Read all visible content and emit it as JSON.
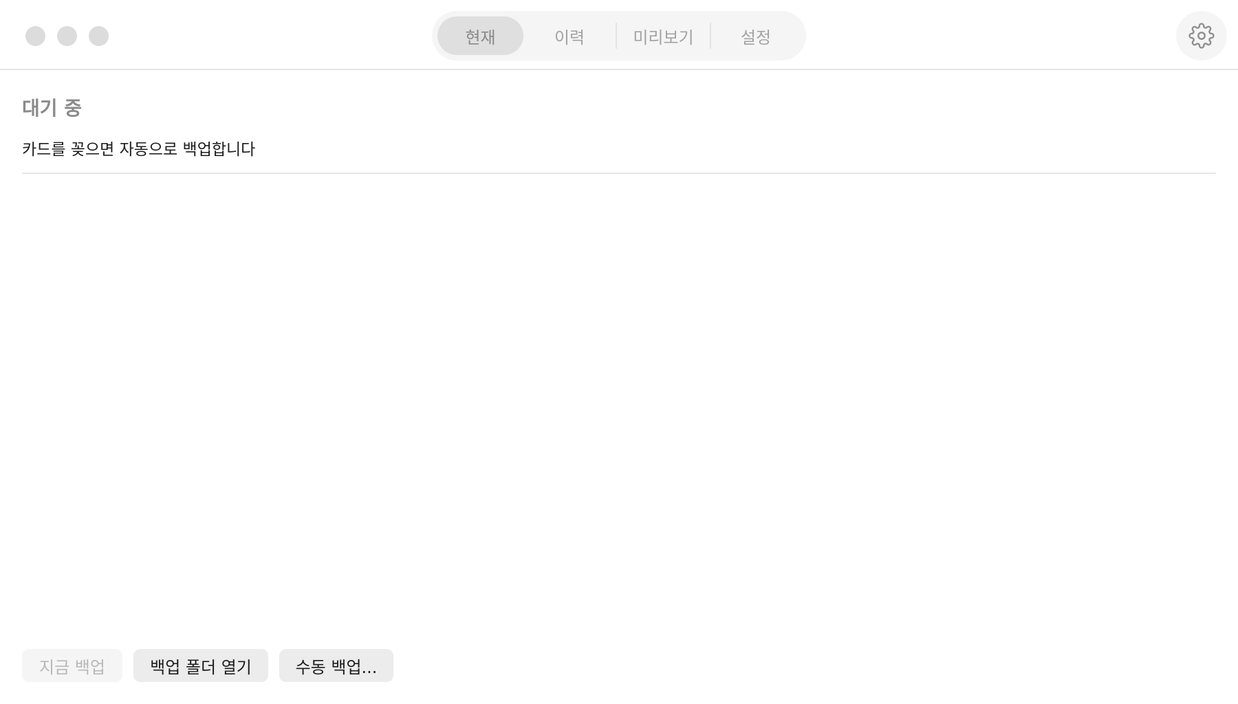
{
  "window": {
    "traffic_lights": [
      "close",
      "minimize",
      "zoom"
    ]
  },
  "tabs": [
    {
      "label": "현재",
      "active": true
    },
    {
      "label": "이력",
      "active": false
    },
    {
      "label": "미리보기",
      "active": false
    },
    {
      "label": "설정",
      "active": false
    }
  ],
  "toolbar": {
    "settings_icon": "gear-icon"
  },
  "status": {
    "title": "대기 중",
    "description": "카드를 꽂으면 자동으로 백업합니다"
  },
  "actions": {
    "backup_now": {
      "label": "지금 백업",
      "enabled": false
    },
    "open_folder": {
      "label": "백업 폴더 열기",
      "enabled": true
    },
    "manual_backup": {
      "label": "수동 백업...",
      "enabled": true
    }
  },
  "colors": {
    "traffic_light_inactive": "#dcdcdc",
    "segmented_bg": "#f5f5f5",
    "segment_active_bg": "#dfdfdf",
    "button_bg": "#ececec"
  }
}
